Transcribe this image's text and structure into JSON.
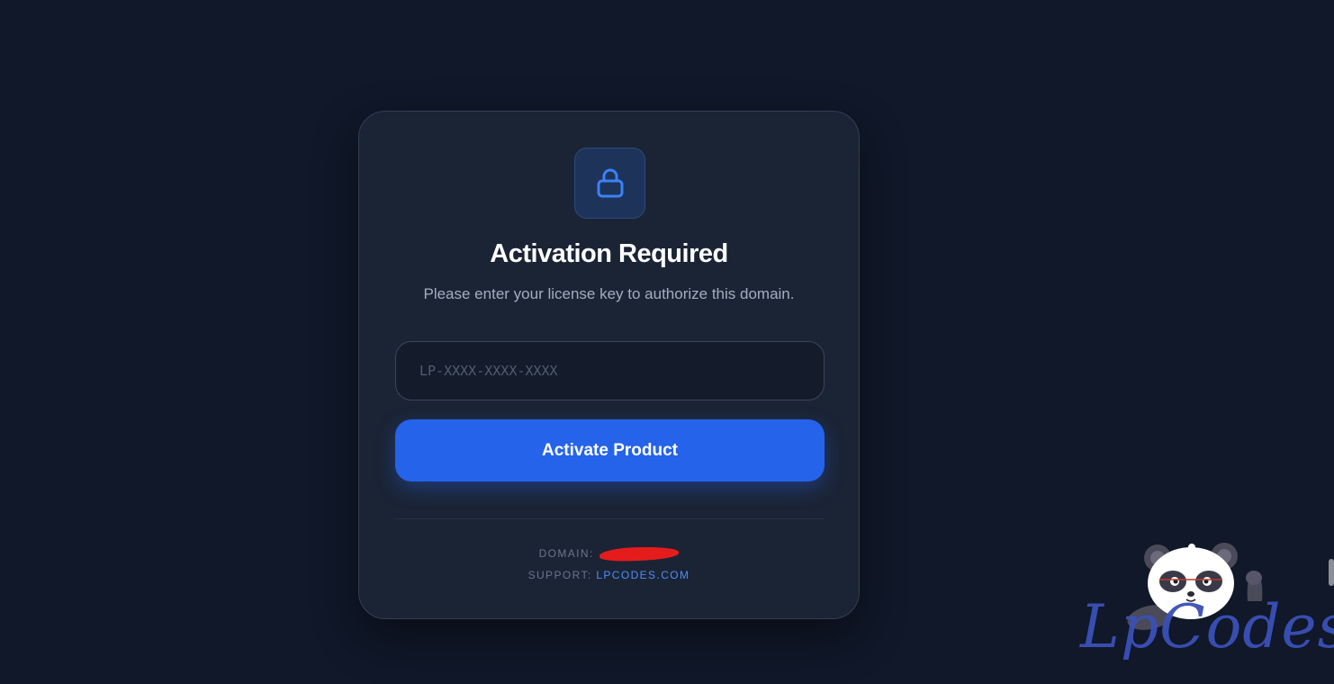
{
  "card": {
    "title": "Activation Required",
    "subtitle": "Please enter your license key to authorize this domain.",
    "license_input": {
      "placeholder": "LP-XXXX-XXXX-XXXX",
      "value": ""
    },
    "activate_button_label": "Activate Product",
    "footer": {
      "domain_label": "DOMAIN:",
      "domain_value": "",
      "support_label": "SUPPORT:",
      "support_link": "LPCODES.COM"
    }
  },
  "icons": {
    "lock": "lock-icon",
    "mascot": "panda-icon"
  },
  "watermark": {
    "text": "LpCodes"
  },
  "colors": {
    "background": "#101829",
    "card": "#1b2435",
    "accent": "#2563eb",
    "link": "#4d8ef7",
    "redaction": "#e51c1c",
    "watermark": "#3b50b8"
  }
}
